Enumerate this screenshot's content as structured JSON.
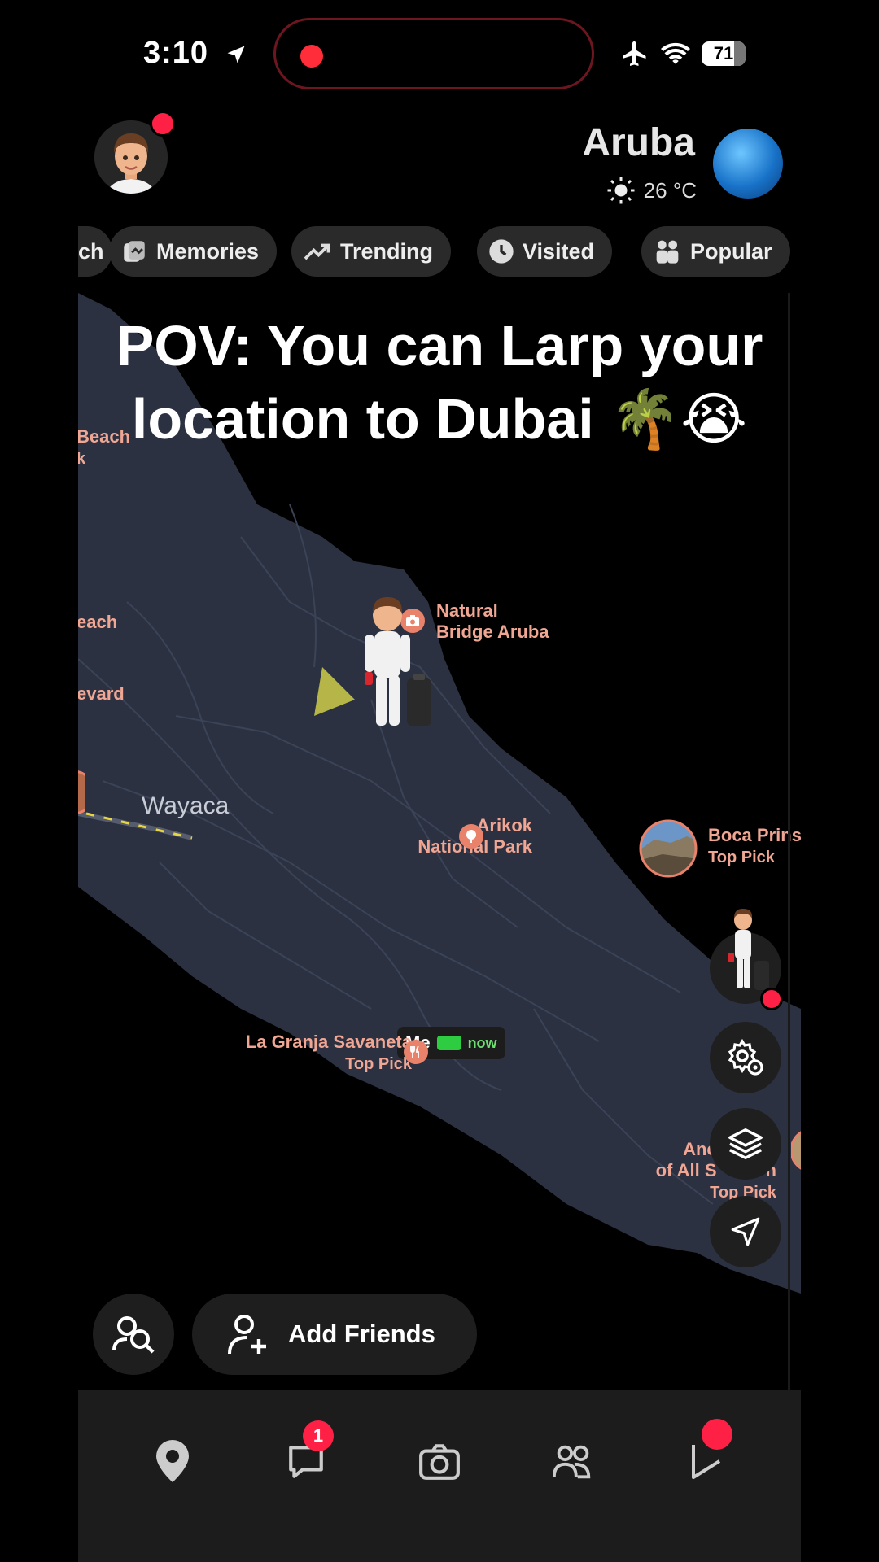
{
  "status_bar": {
    "time": "3:10",
    "battery": "71"
  },
  "header": {
    "location": "Aruba",
    "temperature": "26 °C"
  },
  "chips": [
    {
      "label": "ch"
    },
    {
      "label": "Memories"
    },
    {
      "label": "Trending"
    },
    {
      "label": "Visited"
    },
    {
      "label": "Popular"
    }
  ],
  "headline": "POV: You can Larp your location to Dubai 🌴😭",
  "map": {
    "labels": {
      "beach1": "Beach",
      "beach1_sub": "k",
      "beach2": "each",
      "boulevard": "evard",
      "natural_bridge": "Natural",
      "natural_bridge2": "Bridge Aruba",
      "wayaca": "Wayaca",
      "arikok": "Arikok",
      "arikok2": "National Park",
      "boca": "Boca Prins",
      "boca_sub": "Top Pick",
      "granja": "La Granja Savaneta",
      "granja_sub": "Top Pick",
      "anchor": "Anchor in I",
      "anchor2": "of All S",
      "anchor3": "n",
      "anchor_sub": "Top Pick"
    },
    "me_badge": {
      "label": "Me",
      "time": "now"
    }
  },
  "bottom": {
    "add_friends": "Add Friends",
    "chat_badge": "1"
  },
  "icons": {
    "location_arrow": "location-arrow-icon",
    "airplane": "airplane-icon",
    "wifi": "wifi-icon",
    "sun": "sun-icon"
  },
  "colors": {
    "map_land": "#2b3140",
    "map_label": "#f0a693",
    "notification": "#ff2145"
  }
}
